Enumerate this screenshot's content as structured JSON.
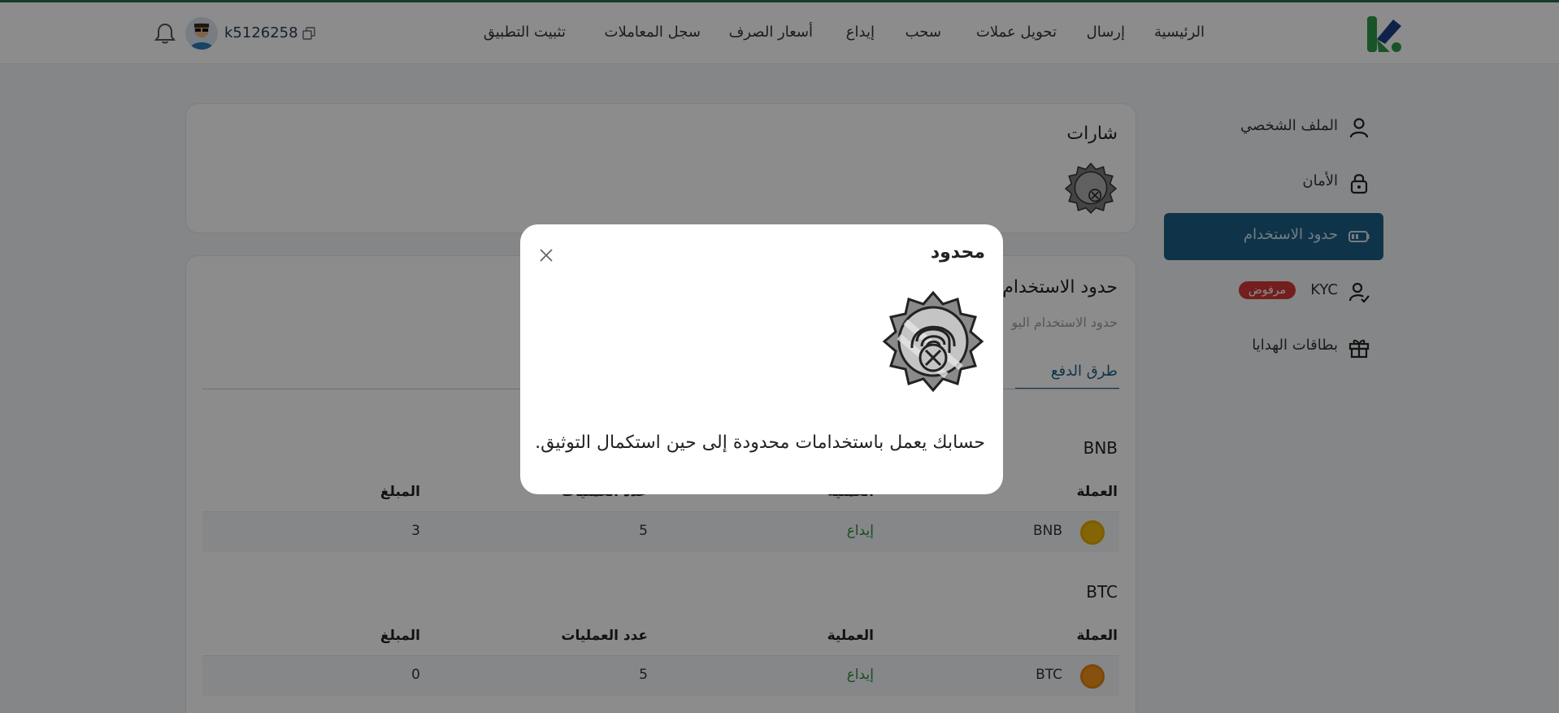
{
  "header": {
    "nav": [
      "الرئيسية",
      "إرسال",
      "تحويل عملات",
      "سحب",
      "إيداع",
      "أسعار الصرف",
      "سجل المعاملات",
      "تثبيت التطبيق"
    ],
    "username": "k5126258"
  },
  "sidebar": {
    "items": [
      {
        "label": "الملف الشخصي",
        "icon": "user-icon"
      },
      {
        "label": "الأمان",
        "icon": "lock-icon"
      },
      {
        "label": "حدود الاستخدام",
        "icon": "battery-icon",
        "active": true
      },
      {
        "label": "KYC",
        "icon": "user-check-icon",
        "badge": "مرفوض"
      },
      {
        "label": "بطاقات الهدايا",
        "icon": "gift-icon"
      }
    ]
  },
  "badges_card": {
    "title": "شارات"
  },
  "limits_card": {
    "title": "حدود الاستخدام",
    "subtitle": "حدود الاستخدام اليو",
    "tab": "طرق الدفع",
    "columns": [
      "العملة",
      "العملية",
      "عدد العمليات",
      "المبلغ"
    ],
    "sections": [
      {
        "title": "BNB",
        "rows": [
          {
            "currency": "BNB",
            "operation": "إيداع",
            "count": "5",
            "amount": "3"
          }
        ]
      },
      {
        "title": "BTC",
        "rows": [
          {
            "currency": "BTC",
            "operation": "إيداع",
            "count": "5",
            "amount": "0"
          }
        ]
      }
    ]
  },
  "modal": {
    "title": "محدود",
    "message": "حسابك يعمل باستخدامات محدودة إلى حين استكمال التوثيق."
  },
  "colors": {
    "accent": "#1d5f86",
    "danger": "#d43a3a",
    "success": "#2e8b3a"
  }
}
